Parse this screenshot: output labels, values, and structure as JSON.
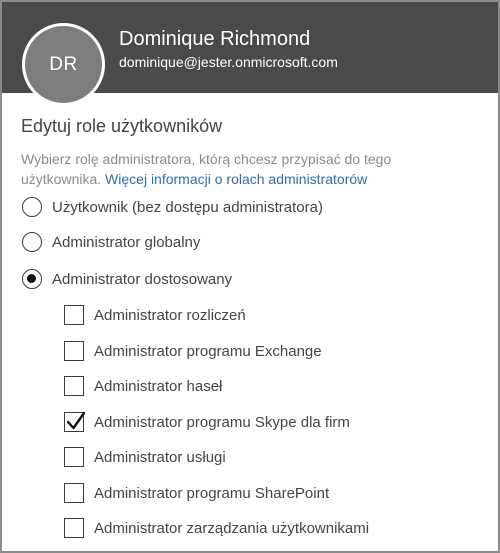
{
  "user": {
    "initials": "DR",
    "name": "Dominique Richmond",
    "email": "dominique@jester.onmicrosoft.com"
  },
  "section": {
    "title": "Edytuj role użytkowników",
    "description": "Wybierz rolę administratora, którą chcesz przypisać do tego użytkownika.",
    "link_text": "Więcej informacji o rolach administratorów"
  },
  "roles": [
    {
      "label": "Użytkownik (bez dostępu administratora)",
      "selected": false
    },
    {
      "label": "Administrator globalny",
      "selected": false
    },
    {
      "label": "Administrator dostosowany",
      "selected": true
    }
  ],
  "custom_roles": [
    {
      "label": "Administrator rozliczeń",
      "checked": false
    },
    {
      "label": "Administrator programu Exchange",
      "checked": false
    },
    {
      "label": "Administrator haseł",
      "checked": false
    },
    {
      "label": "Administrator programu Skype dla firm",
      "checked": true
    },
    {
      "label": "Administrator usługi",
      "checked": false
    },
    {
      "label": "Administrator programu SharePoint",
      "checked": false
    },
    {
      "label": "Administrator zarządzania użytkownikami",
      "checked": false
    }
  ],
  "colors": {
    "header_bg": "#4a4a4a",
    "avatar_bg": "#7d7d7d",
    "link": "#2a6fb0"
  }
}
